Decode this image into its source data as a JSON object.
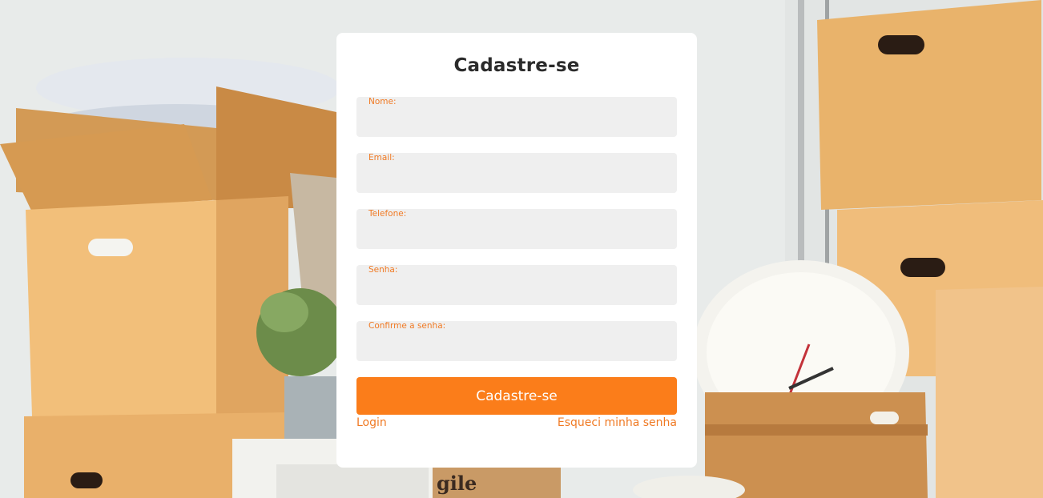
{
  "form": {
    "title": "Cadastre-se",
    "fields": [
      {
        "label": "Nome:",
        "value": ""
      },
      {
        "label": "Email:",
        "value": ""
      },
      {
        "label": "Telefone:",
        "value": ""
      },
      {
        "label": "Senha:",
        "value": ""
      },
      {
        "label": "Confirme a senha:",
        "value": ""
      }
    ],
    "submit_label": "Cadastre-se",
    "login_link": "Login",
    "forgot_link": "Esqueci minha senha"
  },
  "background": {
    "box_text": "gile"
  },
  "colors": {
    "accent": "#fb7d1a",
    "label": "#f07a24",
    "card": "#ffffff",
    "field_bg": "#efefef",
    "title": "#2b2b2b"
  }
}
